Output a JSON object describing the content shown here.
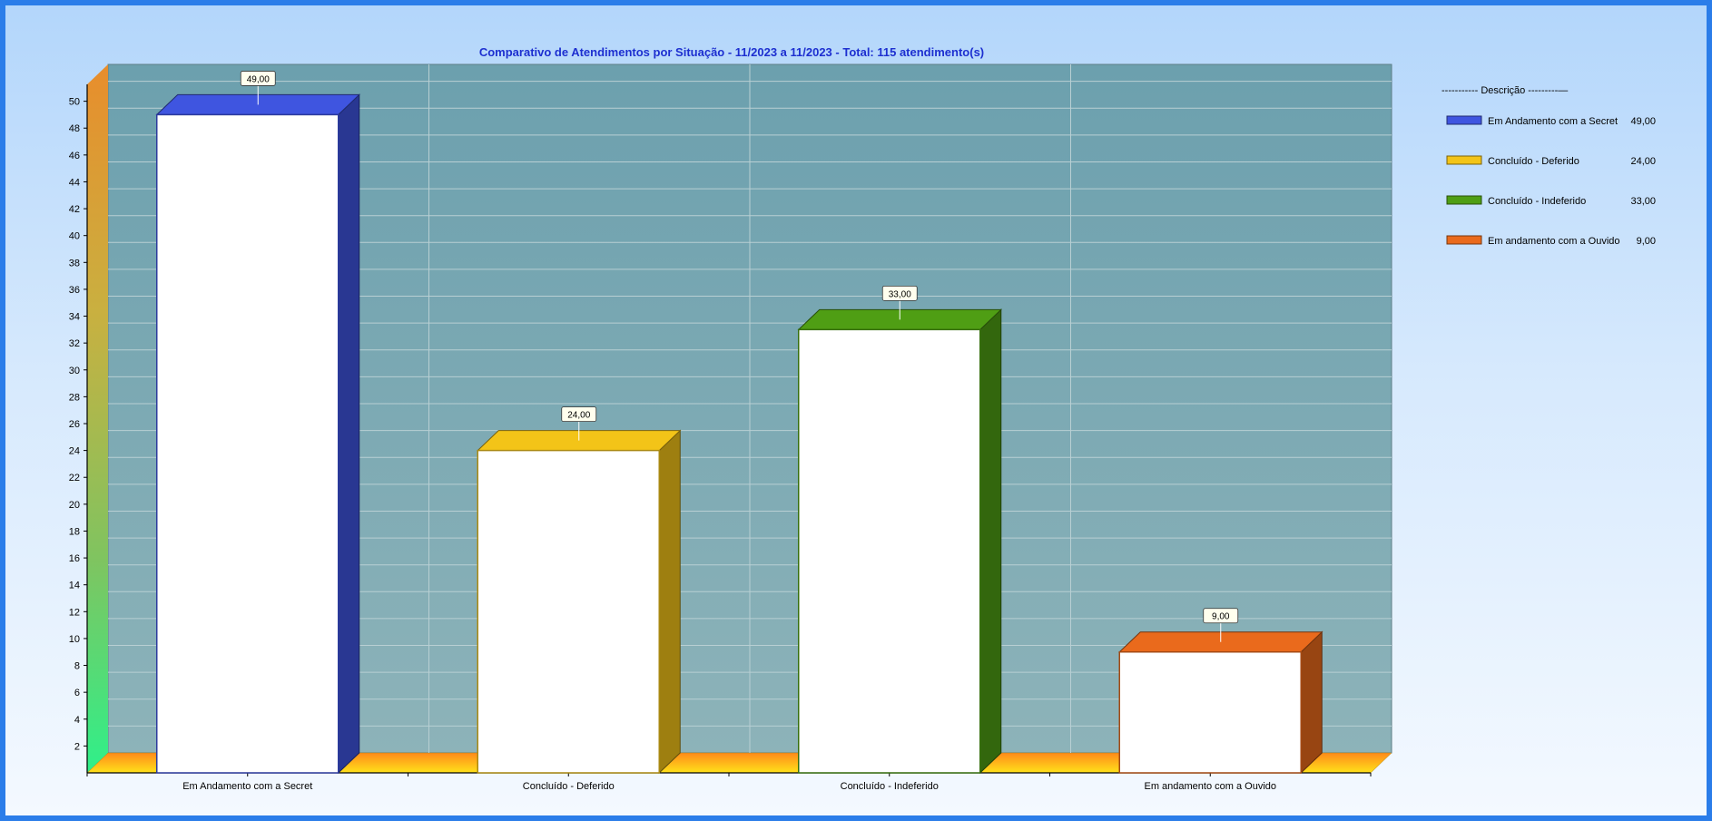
{
  "chart_data": {
    "type": "bar",
    "title": "Comparativo de Atendimentos por Situação - 11/2023 a 11/2023 - Total: 115 atendimento(s)",
    "categories": [
      "Em Andamento com a Secret",
      "Concluído - Deferido",
      "Concluído - Indeferido",
      "Em andamento com a Ouvido"
    ],
    "values": [
      49,
      24,
      33,
      9
    ],
    "data_labels": [
      "49,00",
      "24,00",
      "33,00",
      "9,00"
    ],
    "colors": [
      "#3f55e0",
      "#f3c418",
      "#4f9e14",
      "#ea6a1c"
    ],
    "xlabel": "",
    "ylabel": "",
    "ylim": [
      0,
      52
    ],
    "yticks": [
      2,
      4,
      6,
      8,
      10,
      12,
      14,
      16,
      18,
      20,
      22,
      24,
      26,
      28,
      30,
      32,
      34,
      36,
      38,
      40,
      42,
      44,
      46,
      48,
      50
    ],
    "grid": true,
    "legend_position": "right",
    "legend": {
      "header": "----------- Descrição ---------—",
      "items": [
        {
          "label": "Em Andamento com a Secret",
          "value": "49,00"
        },
        {
          "label": "Concluído - Deferido",
          "value": "24,00"
        },
        {
          "label": "Concluído - Indeferido",
          "value": "33,00"
        },
        {
          "label": "Em andamento com a Ouvido",
          "value": "9,00"
        }
      ]
    }
  }
}
